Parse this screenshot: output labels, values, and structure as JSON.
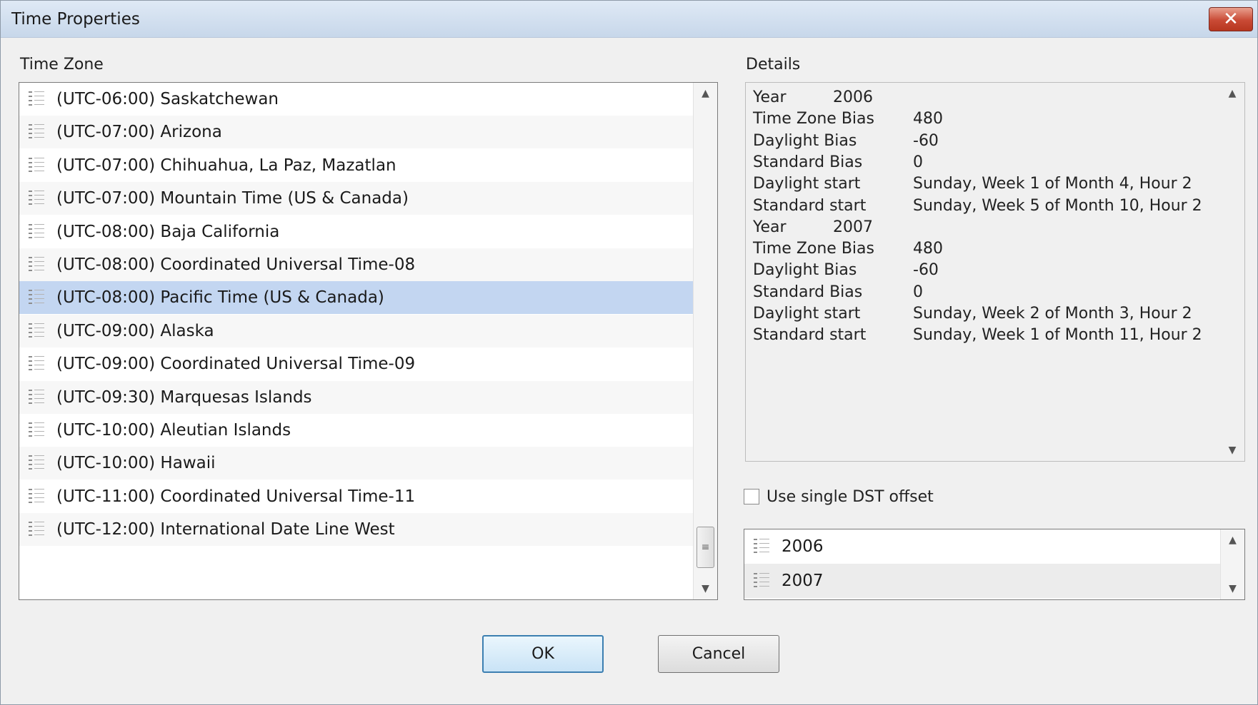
{
  "window": {
    "title": "Time Properties",
    "close_glyph": "✕"
  },
  "time_zone": {
    "label": "Time Zone",
    "items": [
      "(UTC-06:00) Saskatchewan",
      "(UTC-07:00) Arizona",
      "(UTC-07:00) Chihuahua, La Paz, Mazatlan",
      "(UTC-07:00) Mountain Time (US & Canada)",
      "(UTC-08:00) Baja California",
      "(UTC-08:00) Coordinated Universal Time-08",
      "(UTC-08:00) Pacific Time (US & Canada)",
      "(UTC-09:00) Alaska",
      "(UTC-09:00) Coordinated Universal Time-09",
      "(UTC-09:30) Marquesas Islands",
      "(UTC-10:00) Aleutian Islands",
      "(UTC-10:00) Hawaii",
      "(UTC-11:00) Coordinated Universal Time-11",
      "(UTC-12:00) International Date Line West"
    ],
    "selected": "(UTC-08:00) Pacific Time (US & Canada)"
  },
  "details": {
    "label": "Details",
    "lines": [
      {
        "key": "Year",
        "value": "2006",
        "kind": "year"
      },
      {
        "key": "Time Zone Bias",
        "value": "480",
        "kind": "field"
      },
      {
        "key": "Daylight Bias",
        "value": "-60",
        "kind": "field"
      },
      {
        "key": "Standard Bias",
        "value": "0",
        "kind": "field"
      },
      {
        "key": "Daylight start",
        "value": "Sunday, Week 1 of Month 4, Hour 2",
        "kind": "field"
      },
      {
        "key": "Standard start",
        "value": "Sunday, Week 5 of Month 10, Hour 2",
        "kind": "field"
      },
      {
        "key": "Year",
        "value": "2007",
        "kind": "year"
      },
      {
        "key": "Time Zone Bias",
        "value": "480",
        "kind": "field"
      },
      {
        "key": "Daylight Bias",
        "value": "-60",
        "kind": "field"
      },
      {
        "key": "Standard Bias",
        "value": "0",
        "kind": "field"
      },
      {
        "key": "Daylight start",
        "value": "Sunday, Week 2 of Month 3, Hour 2",
        "kind": "field"
      },
      {
        "key": "Standard start",
        "value": "Sunday, Week 1 of Month 11, Hour 2",
        "kind": "field"
      }
    ]
  },
  "dst": {
    "label": "Use single DST offset",
    "checked": false
  },
  "years": {
    "items": [
      "2006",
      "2007"
    ]
  },
  "buttons": {
    "ok": "OK",
    "cancel": "Cancel"
  },
  "scroll": {
    "up_glyph": "▲",
    "down_glyph": "▼",
    "thumb_glyph": "≡"
  }
}
